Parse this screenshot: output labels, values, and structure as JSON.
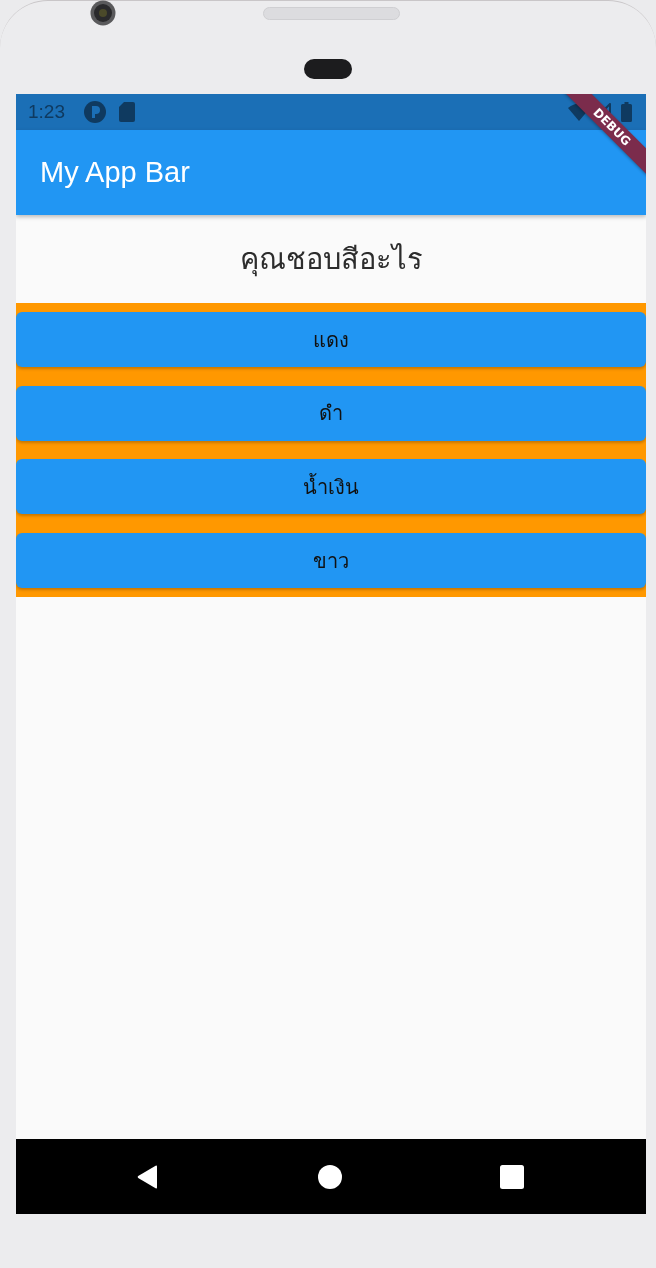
{
  "status_bar": {
    "time": "1:23"
  },
  "debug_banner": {
    "label": "DEBUG"
  },
  "app_bar": {
    "title": "My App Bar"
  },
  "question": "คุณชอบสีอะไร",
  "answers": [
    "แดง",
    "ดำ",
    "น้ำเงิน",
    "ขาว"
  ]
}
